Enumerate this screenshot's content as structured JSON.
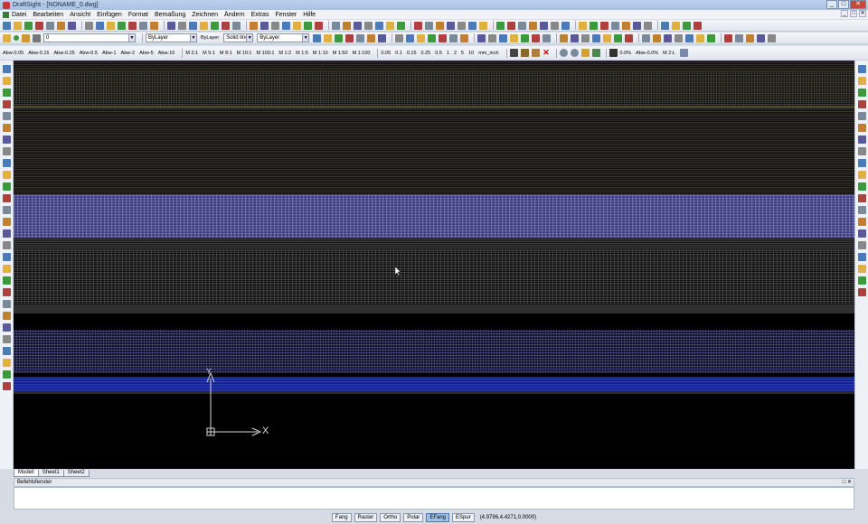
{
  "window": {
    "title": "DraftSight - [NONAME_0.dwg]",
    "controls": [
      "_",
      "□",
      "✕"
    ]
  },
  "menu": {
    "items": [
      "Datei",
      "Bearbeiten",
      "Ansicht",
      "Einfügen",
      "Format",
      "Bemaßung",
      "Zeichnen",
      "Ändern",
      "Extras",
      "Fenster",
      "Hilfe"
    ],
    "doc_controls": [
      "_",
      "□",
      "✕"
    ]
  },
  "toolbar2": {
    "layer_value": "0",
    "color_value": "ByLayer",
    "linetype_label": "ByLayer",
    "linestyle_value": "Solid line",
    "lineweight_value": "ByLayer"
  },
  "toolbar3": {
    "scales": [
      "Abw-0.05",
      "Abw-0.15",
      "Abw-0.25",
      "Abw-0.5",
      "Abw-1",
      "Abw-2",
      "Abw-5",
      "Abw-10"
    ],
    "ratios": [
      "M 2:1",
      "M 5:1",
      "M 8:1",
      "M 10:1",
      "M 100:1",
      "M 1:2",
      "M 1:5",
      "M 1:10",
      "M 1:50",
      "M 1:100"
    ],
    "widths": [
      "0.05",
      "0.1",
      "0.15",
      "0.25",
      "0.5",
      "1",
      "2",
      "5",
      "10"
    ],
    "unit": "mm_inch",
    "percent": "0.0%",
    "abw_pct": "Abw-0.0%",
    "m_value": "M 2:L"
  },
  "canvas": {
    "ucs_y": "Y",
    "ucs_x": "X",
    "background": "#000000"
  },
  "tabs": [
    "Modell",
    "Sheet1",
    "Sheet2"
  ],
  "command": {
    "title": "Befehlsfenster",
    "controls": "□ ✕"
  },
  "status": {
    "buttons": [
      "Fang",
      "Raster",
      "Ortho",
      "Polar",
      "EFang",
      "ESpur"
    ],
    "active": "EFang",
    "coordinates": "(4.9796,4.4271,0.0000)"
  }
}
